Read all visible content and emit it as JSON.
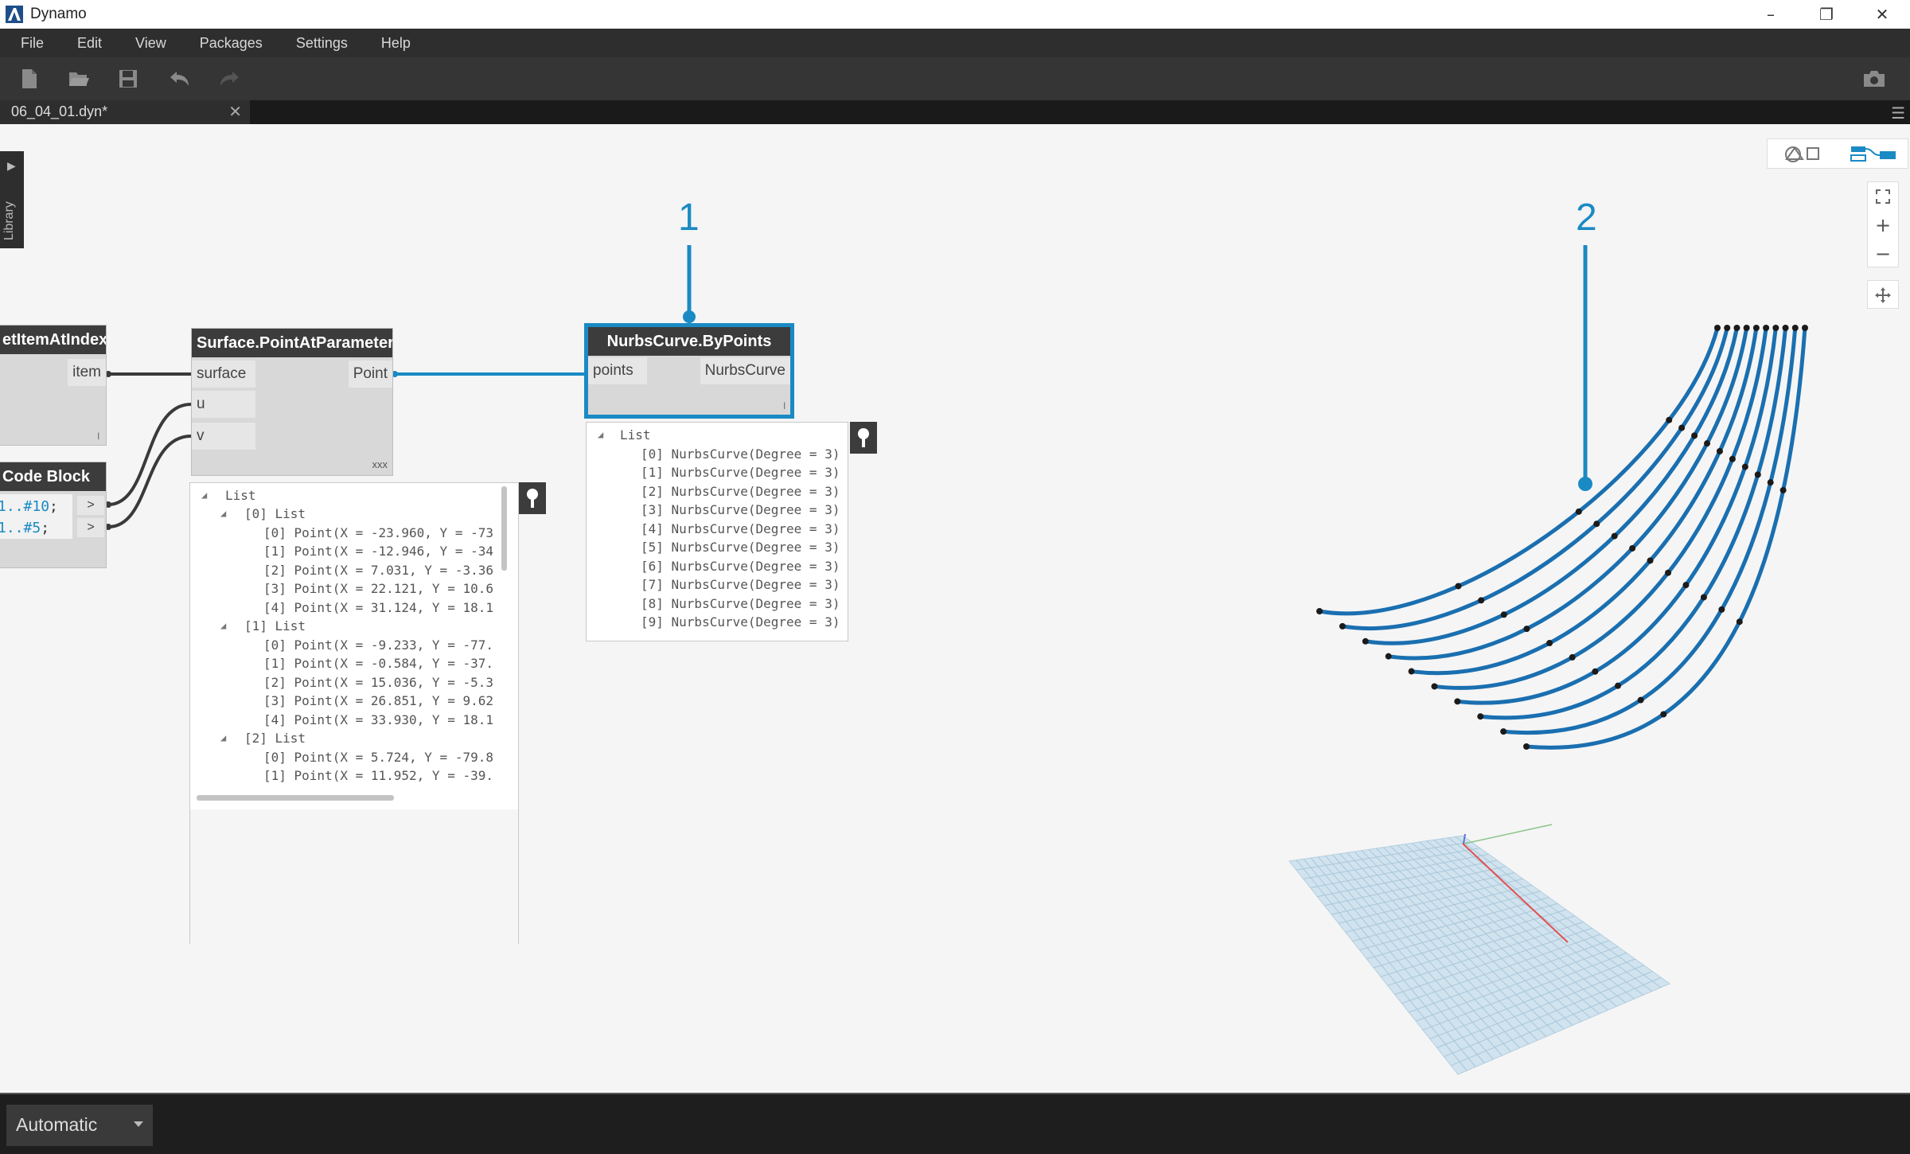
{
  "app": {
    "title": "Dynamo",
    "colors": {
      "accent": "#1a8ac4",
      "curve": "#1a6fb0"
    }
  },
  "window_controls": [
    "minimize-icon",
    "restore-icon",
    "close-icon"
  ],
  "menu": [
    "File",
    "Edit",
    "View",
    "Packages",
    "Settings",
    "Help"
  ],
  "toolbar": {
    "icons": [
      "new-file-icon",
      "open-file-icon",
      "save-icon",
      "undo-icon",
      "redo-icon",
      "camera-icon"
    ]
  },
  "tab": {
    "name": "06_04_01.dyn*",
    "close": "✕",
    "menu": "☰"
  },
  "library": {
    "label": "Library",
    "arrow": "▶"
  },
  "nodes": {
    "get_item": {
      "title": "etItemAtIndex",
      "output": "item",
      "lacing": "l"
    },
    "code_block": {
      "title": "Code Block",
      "line1_a": "1..#",
      "line1_b": "10",
      "line1_c": ";",
      "line2_a": "1..#",
      "line2_b": "5",
      "line2_c": ";",
      "out1": ">",
      "out2": ">"
    },
    "point_at_param": {
      "title": "Surface.PointAtParameter",
      "inputs": [
        "surface",
        "u",
        "v"
      ],
      "output": "Point",
      "lacing": "xxx"
    },
    "nurbs": {
      "title": "NurbsCurve.ByPoints",
      "input": "points",
      "output": "NurbsCurve",
      "lacing": "l"
    }
  },
  "watch_points": {
    "root": "List",
    "groups": [
      {
        "label": "[0] List",
        "items": [
          "[0] Point(X = -23.960, Y = -73",
          "[1] Point(X = -12.946, Y = -34",
          "[2] Point(X = 7.031, Y = -3.36",
          "[3] Point(X = 22.121, Y = 10.6",
          "[4] Point(X = 31.124, Y = 18.1"
        ]
      },
      {
        "label": "[1] List",
        "items": [
          "[0] Point(X = -9.233, Y = -77.",
          "[1] Point(X = -0.584, Y = -37.",
          "[2] Point(X = 15.036, Y = -5.3",
          "[3] Point(X = 26.851, Y = 9.62",
          "[4] Point(X = 33.930, Y = 18.1"
        ]
      },
      {
        "label": "[2] List",
        "items": [
          "[0] Point(X = 5.724, Y = -79.8",
          "[1] Point(X = 11.952, Y = -39."
        ]
      }
    ]
  },
  "watch_curves": {
    "root": "List",
    "items": [
      "[0] NurbsCurve(Degree = 3)",
      "[1] NurbsCurve(Degree = 3)",
      "[2] NurbsCurve(Degree = 3)",
      "[3] NurbsCurve(Degree = 3)",
      "[4] NurbsCurve(Degree = 3)",
      "[5] NurbsCurve(Degree = 3)",
      "[6] NurbsCurve(Degree = 3)",
      "[7] NurbsCurve(Degree = 3)",
      "[8] NurbsCurve(Degree = 3)",
      "[9] NurbsCurve(Degree = 3)"
    ]
  },
  "callouts": [
    "1",
    "2"
  ],
  "view_controls": [
    "geometry-view-icon",
    "graph-view-icon"
  ],
  "zoom_controls": [
    "fit-view-icon",
    "zoom-in-icon",
    "zoom-out-icon",
    "pan-icon"
  ],
  "status": {
    "run_mode": "Automatic"
  }
}
